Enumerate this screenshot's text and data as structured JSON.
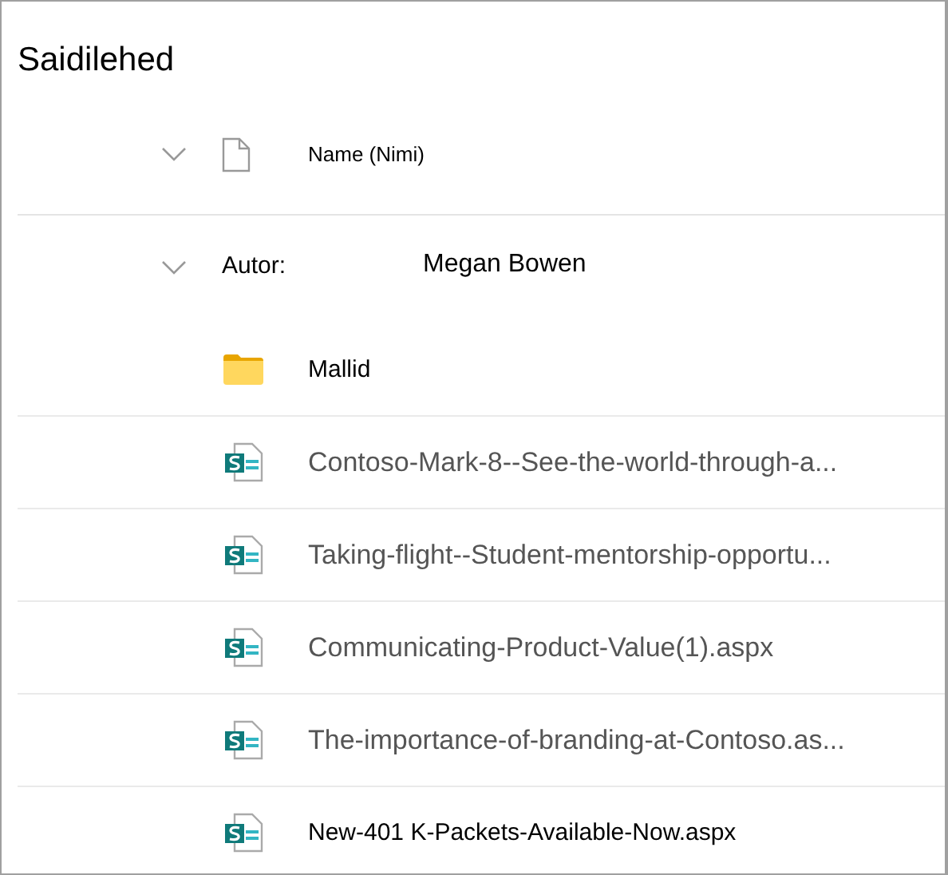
{
  "title": "Saidilehed",
  "header": {
    "column": "Name (Nimi)"
  },
  "group": {
    "label": "Autor:",
    "value": "Megan Bowen",
    "expanded": true
  },
  "items": [
    {
      "kind": "folder",
      "name": "Mallid",
      "muted": false
    },
    {
      "kind": "page",
      "name": "Contoso-Mark-8--See-the-world-through-a...",
      "muted": true
    },
    {
      "kind": "page",
      "name": "Taking-flight--Student-mentorship-opportu...",
      "muted": true
    },
    {
      "kind": "page",
      "name": "Communicating-Product-Value(1).aspx",
      "muted": true
    },
    {
      "kind": "page",
      "name": "The-importance-of-branding-at-Contoso.as...",
      "muted": true
    },
    {
      "kind": "page",
      "name": "New-401 K-Packets-Available-Now.aspx",
      "muted": false
    }
  ]
}
